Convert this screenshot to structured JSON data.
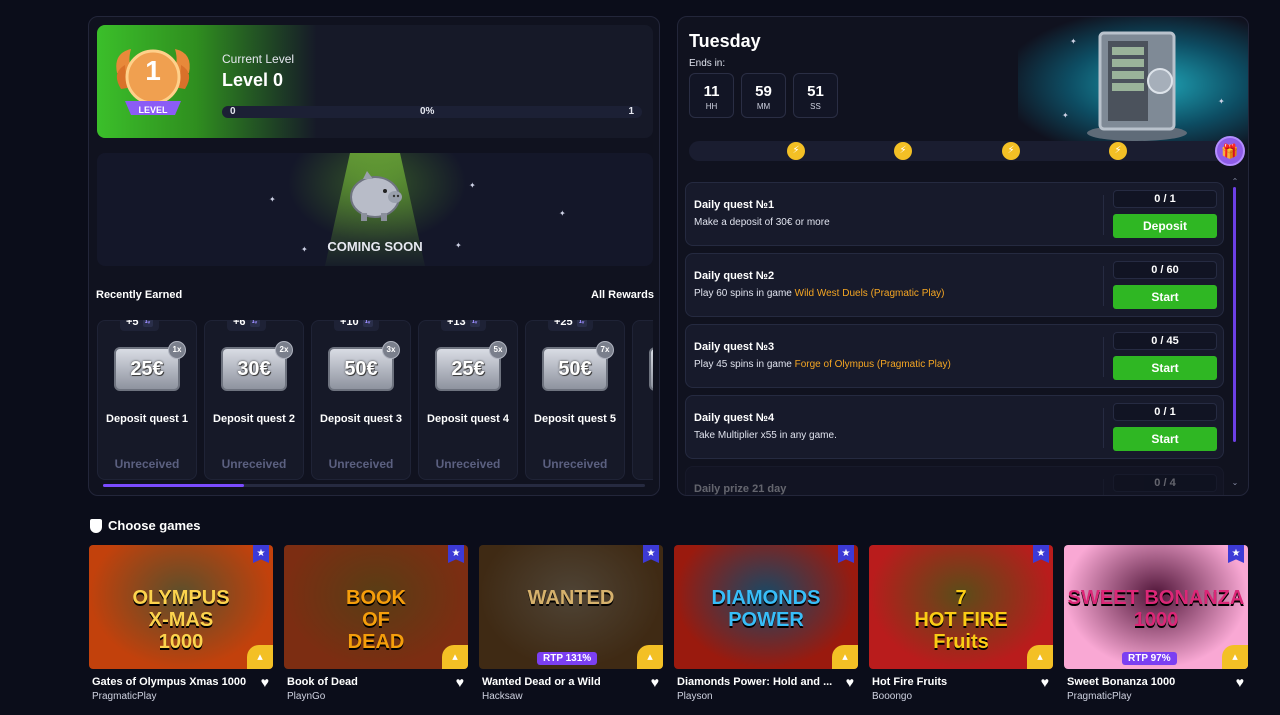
{
  "level": {
    "badge_number": "1",
    "badge_label": "LEVEL",
    "title": "Current Level",
    "value": "Level 0",
    "progress_start": "0",
    "progress_percent": "0%",
    "progress_end": "1"
  },
  "coming_soon": {
    "label": "COMING SOON"
  },
  "rewards": {
    "heading": "Recently Earned",
    "all_link": "All Rewards",
    "items": [
      {
        "bonus": "+5",
        "amount": "25€",
        "multiplier": "1x",
        "title": "Deposit quest 1",
        "status": "Unreceived"
      },
      {
        "bonus": "+6",
        "amount": "30€",
        "multiplier": "2x",
        "title": "Deposit quest 2",
        "status": "Unreceived"
      },
      {
        "bonus": "+10",
        "amount": "50€",
        "multiplier": "3x",
        "title": "Deposit quest 3",
        "status": "Unreceived"
      },
      {
        "bonus": "+13",
        "amount": "25€",
        "multiplier": "5x",
        "title": "Deposit quest 4",
        "status": "Unreceived"
      },
      {
        "bonus": "+25",
        "amount": "50€",
        "multiplier": "7x",
        "title": "Deposit quest 5",
        "status": "Unreceived"
      },
      {
        "bonus": "",
        "amount": "",
        "multiplier": "",
        "title": "De",
        "status": "U"
      }
    ],
    "scroll_progress": 0.26
  },
  "daily": {
    "day": "Tuesday",
    "ends_label": "Ends in:",
    "timer": [
      {
        "value": "11",
        "unit": "HH"
      },
      {
        "value": "59",
        "unit": "MM"
      },
      {
        "value": "51",
        "unit": "SS"
      }
    ],
    "quests": [
      {
        "title": "Daily quest №1",
        "desc": "Make a deposit of 30€ or more",
        "highlight": "",
        "count": "0 / 1",
        "button": "Deposit"
      },
      {
        "title": "Daily quest №2",
        "desc": "Play 60 spins in game ",
        "highlight": "Wild West Duels (Pragmatic Play)",
        "count": "0 / 60",
        "button": "Start"
      },
      {
        "title": "Daily quest №3",
        "desc": "Play 45 spins in game ",
        "highlight": "Forge of Olympus (Pragmatic Play)",
        "count": "0 / 45",
        "button": "Start"
      },
      {
        "title": "Daily quest №4",
        "desc": "Take Multiplier x55 in any game.",
        "highlight": "",
        "count": "0 / 1",
        "button": "Start"
      },
      {
        "title": "Daily prize 21 day",
        "desc": "",
        "highlight": "",
        "count": "0 / 4",
        "button": ""
      }
    ]
  },
  "games": {
    "heading": "Choose games",
    "items": [
      {
        "name": "Gates of Olympus Xmas 1000",
        "provider": "PragmaticPlay",
        "art": "OLYMPUS\nX-MAS\n1000",
        "rtp": "",
        "bg": "#c2410c",
        "accent": "#fcd34d"
      },
      {
        "name": "Book of Dead",
        "provider": "PlaynGo",
        "art": "BOOK\nOF\nDEAD",
        "rtp": "",
        "bg": "#7c2d12",
        "accent": "#f59e0b"
      },
      {
        "name": "Wanted Dead or a Wild",
        "provider": "Hacksaw",
        "art": "WANTED",
        "rtp": "RTP 131%",
        "bg": "#3f2a14",
        "accent": "#d6b16c"
      },
      {
        "name": "Diamonds Power: Hold and ...",
        "provider": "Playson",
        "art": "DIAMONDS\nPOWER",
        "rtp": "",
        "bg": "#9a1a0e",
        "accent": "#38bdf8"
      },
      {
        "name": "Hot Fire Fruits",
        "provider": "Booongo",
        "art": "7\nHOT FIRE\nFruits",
        "rtp": "",
        "bg": "#b91c1c",
        "accent": "#facc15"
      },
      {
        "name": "Sweet Bonanza 1000",
        "provider": "PragmaticPlay",
        "art": "SWEET BONANZA\n1000",
        "rtp": "RTP 97%",
        "bg": "#f9a8d4",
        "accent": "#db2777"
      }
    ]
  },
  "colors": {
    "background": "#0b0d1a",
    "panel": "#10121f",
    "accent_green": "#2fb723",
    "accent_purple": "#7a4bff",
    "accent_orange": "#f5a623",
    "bolt_yellow": "#f3c025"
  }
}
